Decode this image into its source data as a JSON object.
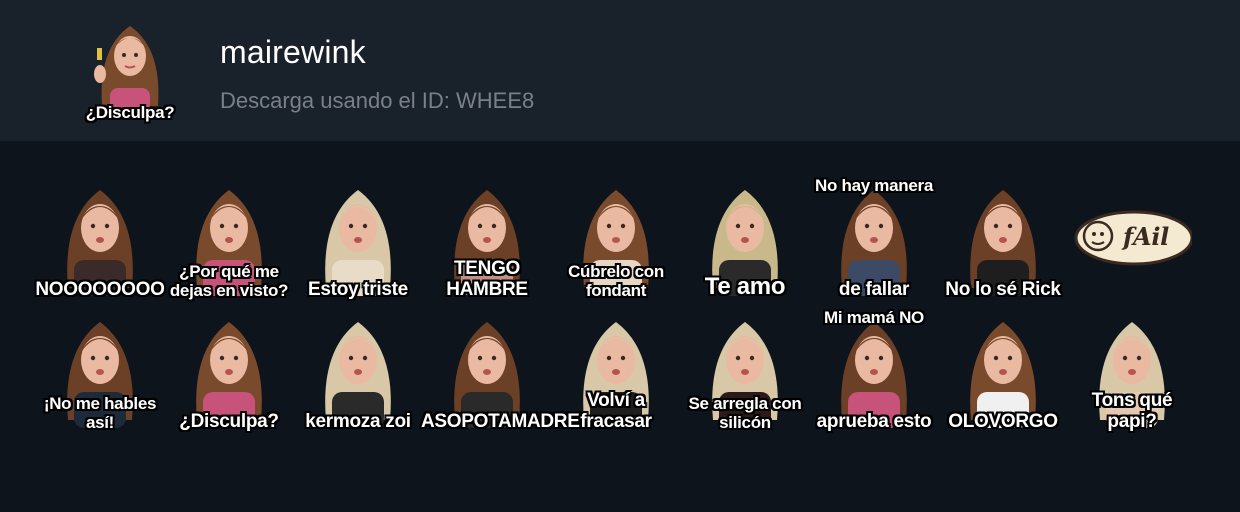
{
  "pack": {
    "title": "mairewink",
    "download_text": "Descarga usando el ID: WHEE8",
    "icon_caption": "¿Disculpa?"
  },
  "stickers_row1": [
    {
      "caption": "NOOOOOOOO",
      "hair": "#6b4027",
      "shirt": "#3a2a2a"
    },
    {
      "caption": "¿Por qué me dejas en visto?",
      "hair": "#7a4a2c",
      "shirt": "#c7537a"
    },
    {
      "caption": "Estoy triste",
      "hair": "#d8c8a8",
      "shirt": "#e8dcc8"
    },
    {
      "caption": "TENGO HAMBRE",
      "hair": "#6b4027",
      "shirt": "#c09080"
    },
    {
      "caption": "Cúbrelo con fondant",
      "hair": "#7a4a2c",
      "shirt": "#e6d6c6"
    },
    {
      "caption": "Te amo",
      "hair": "#c9b98a",
      "shirt": "#2a2a2a"
    },
    {
      "caption_top": "No hay manera",
      "caption": "de fallar",
      "hair": "#6b4027",
      "shirt": "#3d4a66"
    },
    {
      "caption": "No lo sé Rick",
      "hair": "#6b4027",
      "shirt": "#1e1e1e"
    },
    {
      "caption": "fAil",
      "hair": "#ffffff",
      "shirt": "#ffffff"
    }
  ],
  "stickers_row2": [
    {
      "caption": "¡No me hables así!",
      "hair": "#6b4027",
      "shirt": "#1c2a3a"
    },
    {
      "caption": "¿Disculpa?",
      "hair": "#7a4a2c",
      "shirt": "#c7537a"
    },
    {
      "caption": "kermoza zoi",
      "hair": "#d8c8a8",
      "shirt": "#2a2a2a"
    },
    {
      "caption": "ASOPOTAMADRE",
      "hair": "#6b4027",
      "shirt": "#2a2a2a"
    },
    {
      "caption": "Volví a fracasar",
      "hair": "#d8c8a8",
      "shirt": "#1e1e1e"
    },
    {
      "caption": "Se arregla con silicón",
      "hair": "#d8c8a8",
      "shirt": "#2a1a1a"
    },
    {
      "caption_top": "Mi mamá NO",
      "caption": "aprueba esto",
      "hair": "#6b4027",
      "shirt": "#c7537a"
    },
    {
      "caption": "OLOVORGO",
      "hair": "#7a4a2c",
      "shirt": "#f0f0f0"
    },
    {
      "caption": "Tons qué papi?",
      "hair": "#d8c8a8",
      "shirt": "#e6c8b0"
    }
  ],
  "colors": {
    "header_bg": "#19212a",
    "page_bg": "#0e141b",
    "skin": "#e9b9a2"
  }
}
